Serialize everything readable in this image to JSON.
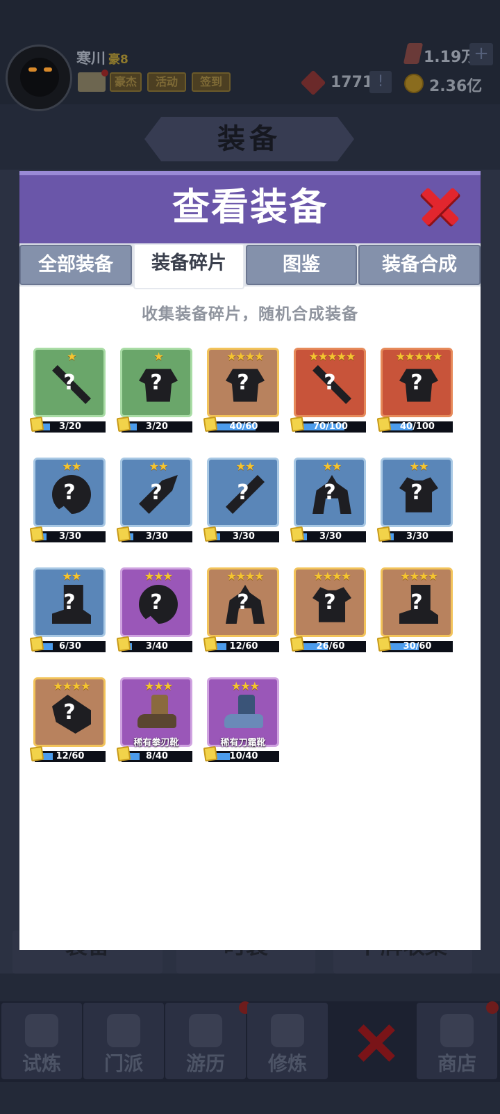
{
  "header": {
    "username": "寒川",
    "vip": "豪8",
    "buttons": [
      "豪杰",
      "活动",
      "签到"
    ],
    "gem_value": "1.19万",
    "plus_label": "+",
    "badge_value": "1771",
    "alert_label": "!",
    "coin_value": "2.36亿",
    "banner_title": "装备"
  },
  "background_tabs": [
    "装备",
    "时装",
    "卜牌收集"
  ],
  "nav": {
    "items": [
      {
        "label": "试炼",
        "icon": "ninja-icon"
      },
      {
        "label": "门派",
        "icon": "temple-icon"
      },
      {
        "label": "游历",
        "icon": "mountain-icon"
      },
      {
        "label": "修炼",
        "icon": "book-icon"
      },
      {
        "label": "",
        "icon": "close-icon"
      },
      {
        "label": "商店",
        "icon": "shop-icon"
      }
    ]
  },
  "modal": {
    "title": "查看装备",
    "tabs": [
      {
        "label": "全部装备",
        "active": false
      },
      {
        "label": "装备碎片",
        "active": true
      },
      {
        "label": "图鉴",
        "active": false
      },
      {
        "label": "装备合成",
        "active": false
      }
    ],
    "subtitle": "收集装备碎片，随机合成装备",
    "fragments": [
      {
        "stars": "★",
        "quality": "q1",
        "shape": "weapon",
        "label": "?",
        "progress_text": "3/20",
        "progress": 0.15
      },
      {
        "stars": "★",
        "quality": "q1",
        "shape": "armor",
        "label": "?",
        "progress_text": "3/20",
        "progress": 0.15
      },
      {
        "stars": "★★★★",
        "quality": "q4",
        "shape": "armor",
        "label": "?",
        "progress_text": "40/60",
        "progress": 0.667
      },
      {
        "stars": "★★★★★",
        "quality": "q5",
        "shape": "weapon",
        "label": "?",
        "progress_text": "70/100",
        "progress": 0.7
      },
      {
        "stars": "★★★★★",
        "quality": "q5",
        "shape": "armor",
        "label": "?",
        "progress_text": "40/100",
        "progress": 0.4
      },
      {
        "stars": "★★",
        "quality": "q2",
        "shape": "ring",
        "label": "?",
        "progress_text": "3/30",
        "progress": 0.1
      },
      {
        "stars": "★★",
        "quality": "q2",
        "shape": "blade",
        "label": "?",
        "progress_text": "3/30",
        "progress": 0.1
      },
      {
        "stars": "★★",
        "quality": "q2",
        "shape": "stick",
        "label": "?",
        "progress_text": "3/30",
        "progress": 0.1
      },
      {
        "stars": "★★",
        "quality": "q2",
        "shape": "helm",
        "label": "?",
        "progress_text": "3/30",
        "progress": 0.1
      },
      {
        "stars": "★★",
        "quality": "q2",
        "shape": "shirt",
        "label": "?",
        "progress_text": "3/30",
        "progress": 0.1
      },
      {
        "stars": "★★",
        "quality": "q2",
        "shape": "boot",
        "label": "?",
        "progress_text": "6/30",
        "progress": 0.2
      },
      {
        "stars": "★★★",
        "quality": "q3",
        "shape": "ring",
        "label": "?",
        "progress_text": "3/40",
        "progress": 0.075
      },
      {
        "stars": "★★★★",
        "quality": "q4",
        "shape": "helm",
        "label": "?",
        "progress_text": "12/60",
        "progress": 0.2
      },
      {
        "stars": "★★★★",
        "quality": "q4",
        "shape": "shirt",
        "label": "?",
        "progress_text": "26/60",
        "progress": 0.433
      },
      {
        "stars": "★★★★",
        "quality": "q4",
        "shape": "boot",
        "label": "?",
        "progress_text": "30/60",
        "progress": 0.5
      },
      {
        "stars": "★★★★",
        "quality": "q4",
        "shape": "glove",
        "label": "?",
        "progress_text": "12/60",
        "progress": 0.2
      },
      {
        "stars": "★★★",
        "quality": "q3",
        "shape": "boot-brown",
        "label": "稀有拳刃靴",
        "progress_text": "8/40",
        "progress": 0.2
      },
      {
        "stars": "★★★",
        "quality": "q3",
        "shape": "boot-blue",
        "label": "稀有刀霜靴",
        "progress_text": "10/40",
        "progress": 0.25
      }
    ]
  },
  "colors": {
    "modal_header": "#6a56a9",
    "tab_inactive": "#8491ab",
    "progress_fill": "#4c9cec",
    "close_red": "#e2262e",
    "star_gold": "#f5c531"
  }
}
